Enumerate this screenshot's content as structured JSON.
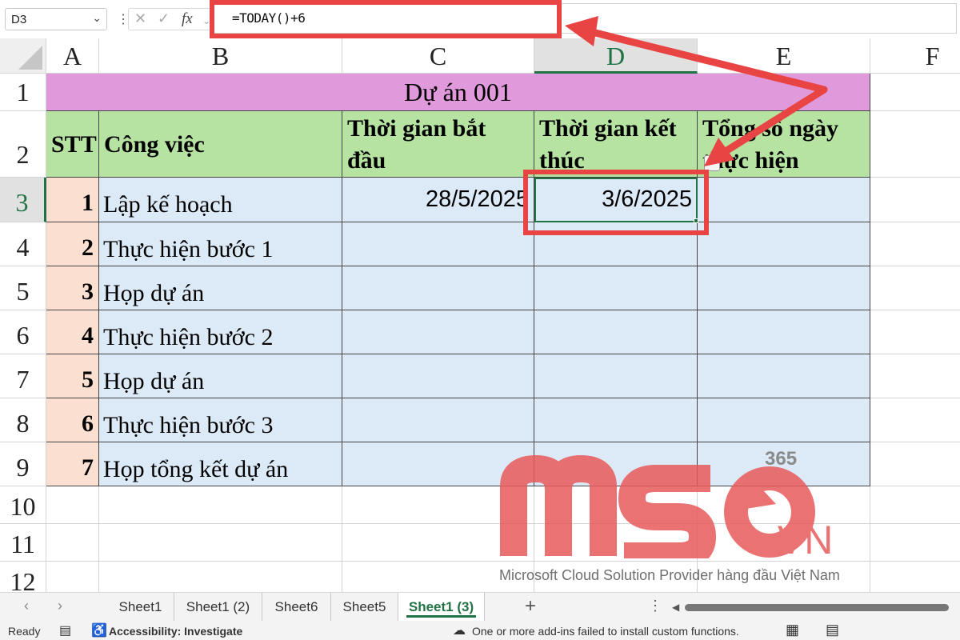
{
  "formula_bar": {
    "name_box": "D3",
    "formula": "=TODAY()+6"
  },
  "columns": [
    "A",
    "B",
    "C",
    "D",
    "E",
    "F"
  ],
  "rows": [
    "1",
    "2",
    "3",
    "4",
    "5",
    "6",
    "7",
    "8",
    "9",
    "10",
    "11",
    "12"
  ],
  "sheet": {
    "title": "Dự án 001",
    "headers": {
      "stt": "STT",
      "task": "Công việc",
      "start": "Thời gian bắt đầu",
      "end": "Thời gian kết thúc",
      "total": "Tổng số ngày thực hiện"
    },
    "tasks": [
      {
        "stt": "1",
        "name": "Lập kế hoạch",
        "start": "28/5/2025",
        "end": "3/6/2025"
      },
      {
        "stt": "2",
        "name": "Thực hiện bước 1"
      },
      {
        "stt": "3",
        "name": "Họp dự án"
      },
      {
        "stt": "4",
        "name": "Thực hiện bước 2"
      },
      {
        "stt": "5",
        "name": "Họp dự án"
      },
      {
        "stt": "6",
        "name": "Thực hiện bước 3"
      },
      {
        "stt": "7",
        "name": "Họp tổng kết dự án"
      }
    ]
  },
  "watermark": {
    "number": "365",
    "logo_text": "MSO",
    "logo_suffix": ".VN",
    "tagline": "Microsoft Cloud Solution Provider hàng đầu Việt Nam"
  },
  "sheet_tabs": [
    "Sheet1",
    "Sheet1 (2)",
    "Sheet6",
    "Sheet5",
    "Sheet1 (3)"
  ],
  "active_tab": "Sheet1 (3)",
  "status_bar": {
    "ready": "Ready",
    "accessibility": "Accessibility: Investigate",
    "message": "One or more add-ins failed to install custom functions."
  },
  "colors": {
    "title_fill": "#e09adb",
    "header_fill": "#b6e3a1",
    "stt_fill": "#fbe0d2",
    "body_fill": "#dceaf7",
    "annotation": "#e84444",
    "excel_green": "#217346"
  },
  "icons": [
    "chevron-down-icon",
    "cancel-icon",
    "check-icon",
    "function-icon",
    "arrow-left-icon",
    "arrow-right-icon",
    "add-sheet-icon",
    "more-icon",
    "macro-icon",
    "accessibility-icon",
    "cloud-warning-icon",
    "normal-view-icon",
    "page-layout-icon"
  ]
}
